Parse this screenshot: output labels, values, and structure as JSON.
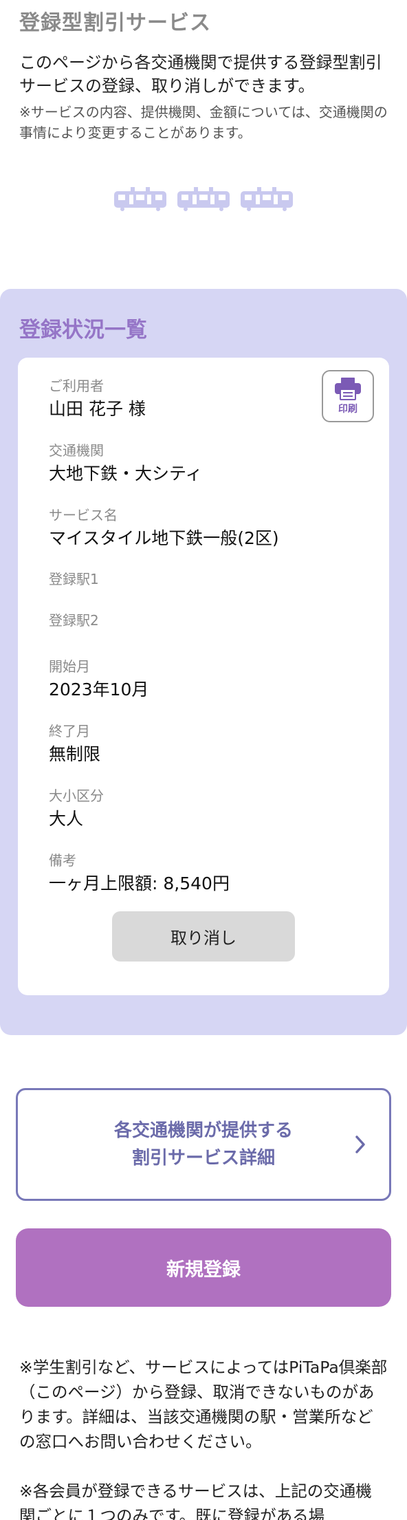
{
  "header": {
    "title": "登録型割引サービス",
    "intro": "このページから各交通機関で提供する登録型割引サービスの登録、取り消しができます。",
    "note": "※サービスの内容、提供機関、金額については、交通機関の事情により変更することがあります。"
  },
  "status": {
    "title": "登録状況一覧",
    "print_label": "印刷",
    "fields": [
      {
        "label": "ご利用者",
        "value": "山田 花子 様"
      },
      {
        "label": "交通機関",
        "value": "大地下鉄・大シティ"
      },
      {
        "label": "サービス名",
        "value": "マイスタイル地下鉄一般(2区)"
      },
      {
        "label": "登録駅1",
        "value": ""
      },
      {
        "label": "登録駅2",
        "value": ""
      },
      {
        "label": "開始月",
        "value": "2023年10月"
      },
      {
        "label": "終了月",
        "value": "無制限"
      },
      {
        "label": "大小区分",
        "value": "大人"
      },
      {
        "label": "備考",
        "value": "一ヶ月上限額: 8,540円"
      }
    ],
    "cancel_label": "取り消し"
  },
  "details_button": {
    "line1": "各交通機関が提供する",
    "line2": "割引サービス詳細"
  },
  "register_label": "新規登録",
  "footnotes": [
    "※学生割引など、サービスによってはPiTaPa倶楽部（このページ）から登録、取消できないものがあります。詳細は、当該交通機関の駅・営業所などの窓口へお問い合わせください。",
    "※各会員が登録できるサービスは、上記の交通機関ごとに１つのみです。既に登録がある場"
  ],
  "colors": {
    "status_bg": "#d6d6f4",
    "accent_purple": "#9575c7",
    "register_button": "#b071c0",
    "details_border": "#7878b8",
    "train_icon": "#c9c9ef"
  }
}
